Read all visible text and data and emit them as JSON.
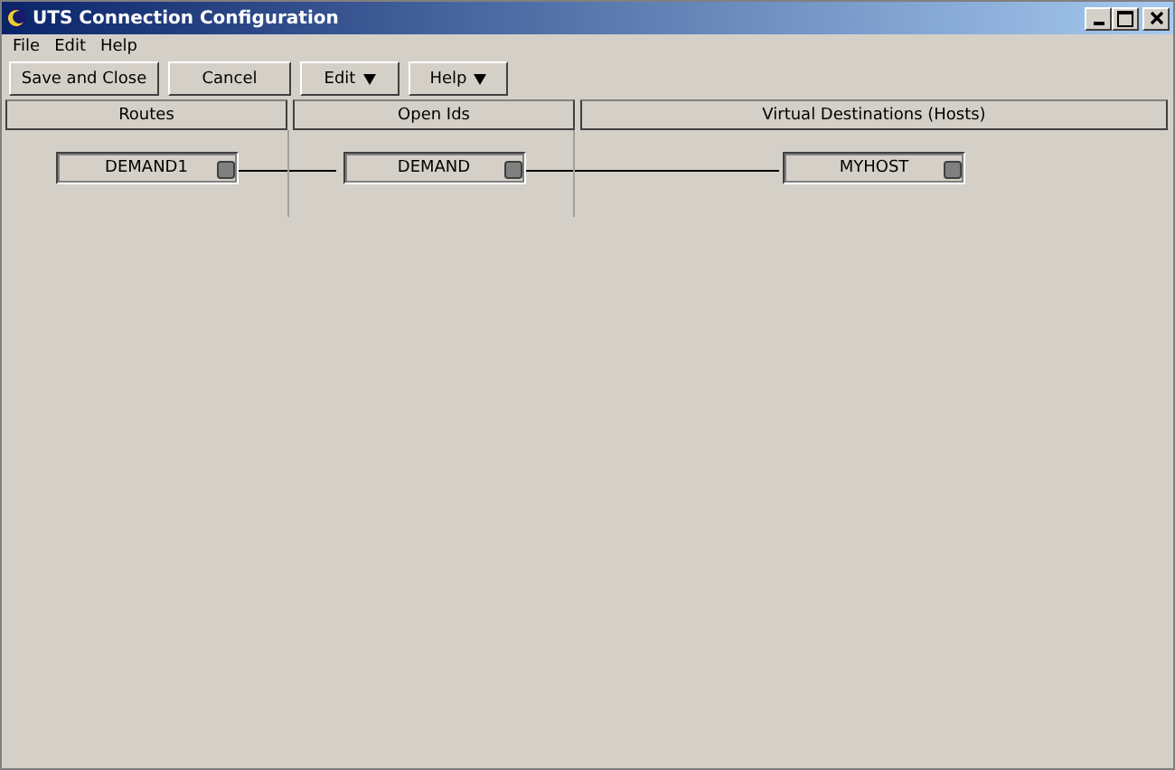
{
  "window": {
    "title": "UTS Connection Configuration"
  },
  "menu": [
    "File",
    "Edit",
    "Help"
  ],
  "toolbar": [
    {
      "label": "Save and Close",
      "kind": "button"
    },
    {
      "label": "Cancel",
      "kind": "button"
    },
    {
      "label": "Edit",
      "kind": "dropdown"
    },
    {
      "label": "Help",
      "kind": "dropdown"
    }
  ],
  "columns": [
    {
      "title": "Routes",
      "nodes": [
        {
          "label": "DEMAND1"
        }
      ]
    },
    {
      "title": "Open Ids",
      "nodes": [
        {
          "label": "DEMAND"
        }
      ]
    },
    {
      "title": "Virtual Destinations (Hosts)",
      "nodes": [
        {
          "label": "MYHOST"
        }
      ]
    }
  ]
}
